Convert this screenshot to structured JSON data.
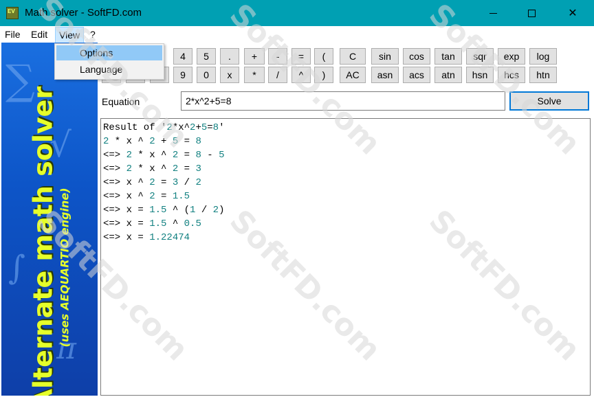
{
  "window": {
    "title": "Math solver - SoftFD.com",
    "icon_text": "EV"
  },
  "menu": {
    "file": "File",
    "edit": "Edit",
    "view": "View",
    "help": "?"
  },
  "view_menu": {
    "options": "Options",
    "language": "Language"
  },
  "banner": {
    "title": "Alternate math solver",
    "subtitle": "(uses AEQUARTIO engine)"
  },
  "keypad": {
    "row1": [
      "4",
      "5",
      ".",
      "+",
      "-",
      "=",
      "(",
      "C",
      "sin",
      "cos",
      "tan",
      "sqr",
      "exp",
      "log"
    ],
    "row2": [
      "9",
      "0",
      "x",
      "*",
      "/",
      "^",
      ")",
      "AC",
      "asn",
      "acs",
      "atn",
      "hsn",
      "hcs",
      "htn"
    ]
  },
  "equation": {
    "label": "Equation",
    "value": "2*x^2+5=8"
  },
  "solve_label": "Solve",
  "result_lines": [
    "Result of '2*x^2+5=8'",
    "2 * x ^ 2 + 5 = 8",
    "<=> 2 * x ^ 2 = 8 - 5",
    "<=> 2 * x ^ 2 = 3",
    "<=> x ^ 2 = 3 / 2",
    "<=> x ^ 2 = 1.5",
    "<=> x = 1.5 ^ (1 / 2)",
    "<=> x = 1.5 ^ 0.5",
    "<=> x = 1.22474"
  ],
  "watermark": "SoftFD.com",
  "colors": {
    "titlebar": "#00a0b3",
    "number": "#118080",
    "banner_text": "#e6ff2a",
    "banner_bg": "#0d55c8",
    "menu_highlight": "#91c9f7"
  }
}
